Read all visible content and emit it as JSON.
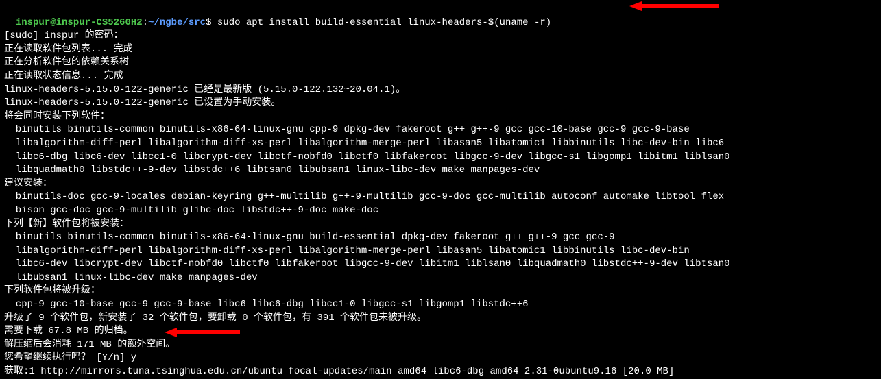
{
  "prompt": {
    "user_host": "inspur@inspur-CS5260H2",
    "colon": ":",
    "path": "~/ngbe/src",
    "dollar": "$ ",
    "command": "sudo apt install build-essential linux-headers-$(uname -r)"
  },
  "lines": [
    "[sudo] inspur 的密码：",
    "正在读取软件包列表... 完成",
    "正在分析软件包的依赖关系树",
    "正在读取状态信息... 完成",
    "linux-headers-5.15.0-122-generic 已经是最新版 (5.15.0-122.132~20.04.1)。",
    "linux-headers-5.15.0-122-generic 已设置为手动安装。",
    "将会同时安装下列软件：",
    "  binutils binutils-common binutils-x86-64-linux-gnu cpp-9 dpkg-dev fakeroot g++ g++-9 gcc gcc-10-base gcc-9 gcc-9-base",
    "  libalgorithm-diff-perl libalgorithm-diff-xs-perl libalgorithm-merge-perl libasan5 libatomic1 libbinutils libc-dev-bin libc6",
    "  libc6-dbg libc6-dev libcc1-0 libcrypt-dev libctf-nobfd0 libctf0 libfakeroot libgcc-9-dev libgcc-s1 libgomp1 libitm1 liblsan0",
    "  libquadmath0 libstdc++-9-dev libstdc++6 libtsan0 libubsan1 linux-libc-dev make manpages-dev",
    "建议安装：",
    "  binutils-doc gcc-9-locales debian-keyring g++-multilib g++-9-multilib gcc-9-doc gcc-multilib autoconf automake libtool flex",
    "  bison gcc-doc gcc-9-multilib glibc-doc libstdc++-9-doc make-doc",
    "下列【新】软件包将被安装：",
    "  binutils binutils-common binutils-x86-64-linux-gnu build-essential dpkg-dev fakeroot g++ g++-9 gcc gcc-9",
    "  libalgorithm-diff-perl libalgorithm-diff-xs-perl libalgorithm-merge-perl libasan5 libatomic1 libbinutils libc-dev-bin",
    "  libc6-dev libcrypt-dev libctf-nobfd0 libctf0 libfakeroot libgcc-9-dev libitm1 liblsan0 libquadmath0 libstdc++-9-dev libtsan0",
    "  libubsan1 linux-libc-dev make manpages-dev",
    "下列软件包将被升级：",
    "  cpp-9 gcc-10-base gcc-9 gcc-9-base libc6 libc6-dbg libcc1-0 libgcc-s1 libgomp1 libstdc++6",
    "升级了 9 个软件包，新安装了 32 个软件包，要卸载 0 个软件包，有 391 个软件包未被升级。",
    "需要下载 67.8 MB 的归档。",
    "解压缩后会消耗 171 MB 的额外空间。",
    "您希望继续执行吗？ [Y/n] y",
    "获取:1 http://mirrors.tuna.tsinghua.edu.cn/ubuntu focal-updates/main amd64 libc6-dbg amd64 2.31-0ubuntu9.16 [20.0 MB]"
  ]
}
